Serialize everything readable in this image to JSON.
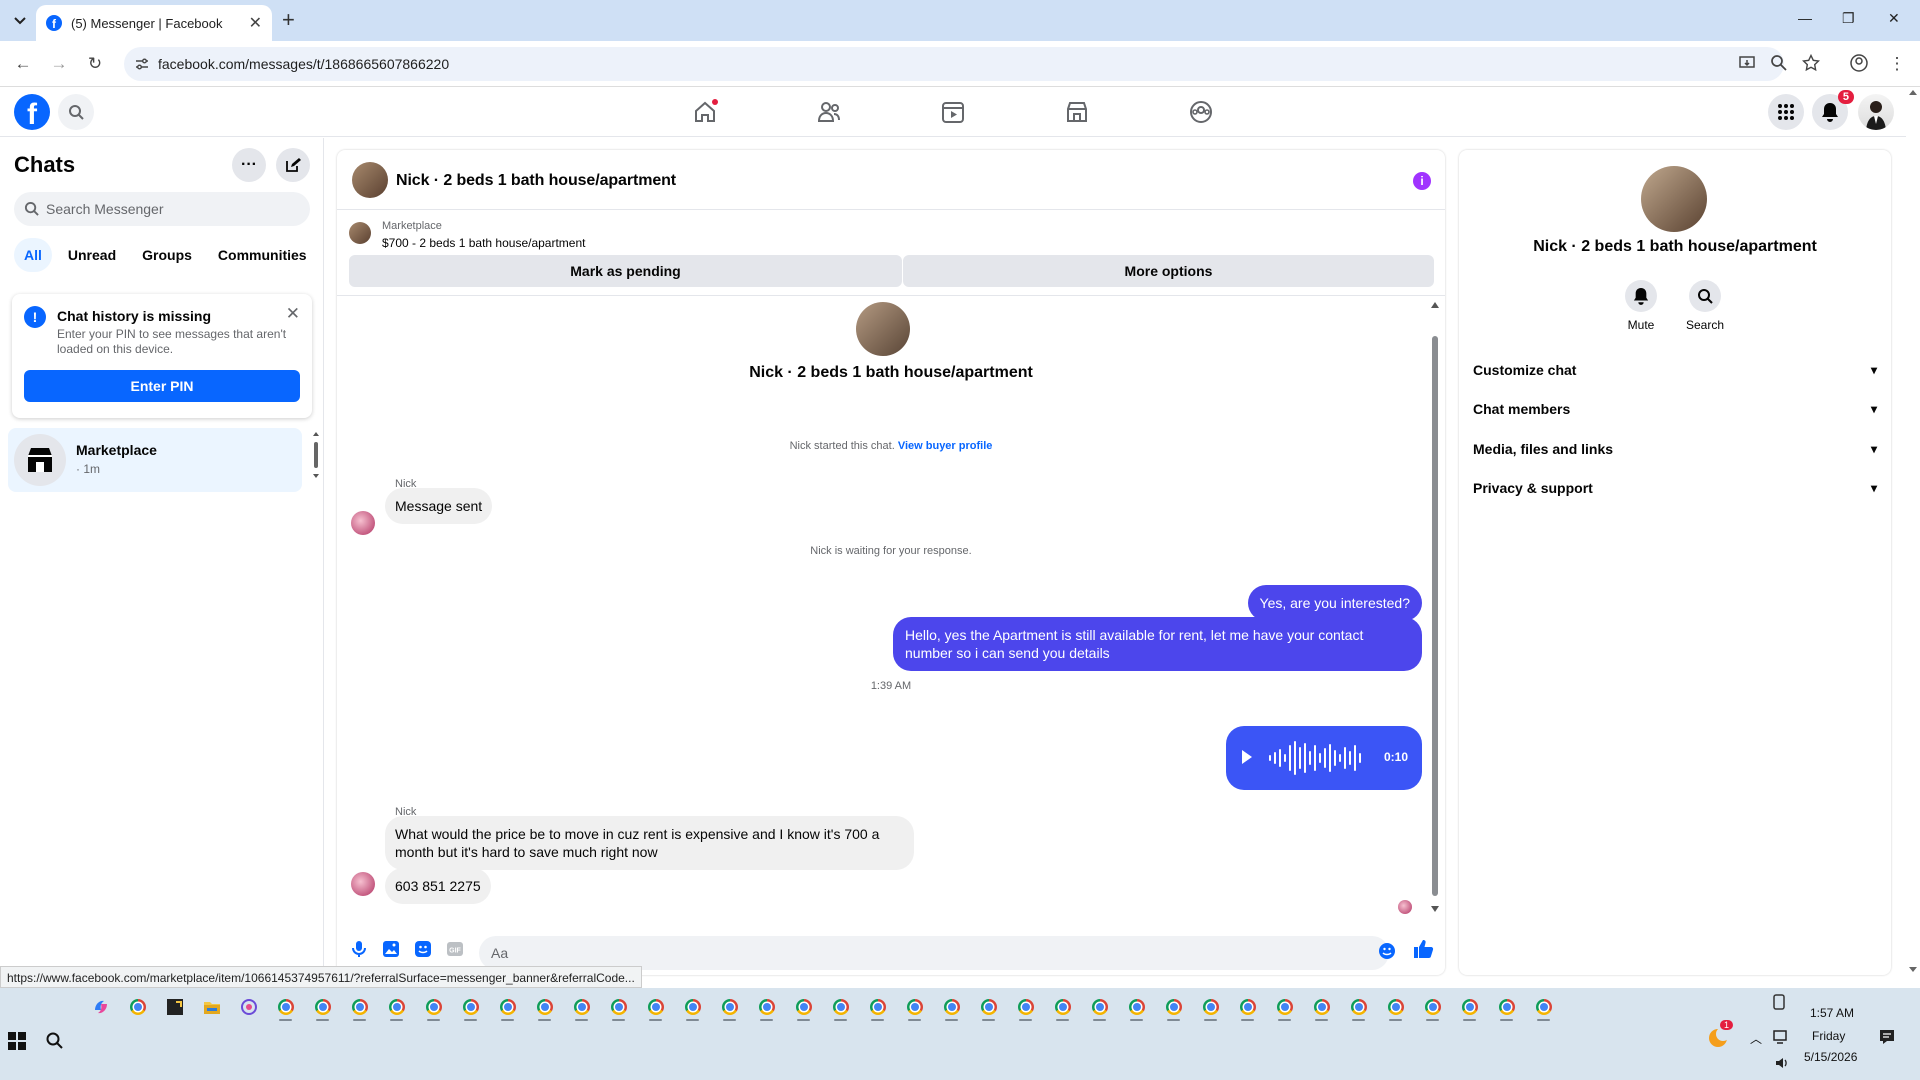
{
  "browser": {
    "tab_title": "(5) Messenger | Facebook",
    "url": "facebook.com/messages/t/1868665607866220",
    "status_url": "https://www.facebook.com/marketplace/item/1066145374957611/?referralSurface=messenger_banner&referralCode..."
  },
  "fb": {
    "notif_count": "5"
  },
  "sidebar": {
    "title": "Chats",
    "search_placeholder": "Search Messenger",
    "filters": [
      "All",
      "Unread",
      "Groups",
      "Communities"
    ],
    "notice": {
      "title": "Chat history is missing",
      "desc": "Enter your PIN to see messages that aren't loaded on this device.",
      "button": "Enter PIN"
    },
    "conversation": {
      "name": "Marketplace",
      "snippet": "· 1m"
    }
  },
  "chat": {
    "header_name": "Nick · 2 beds 1 bath house/apartment",
    "banner": {
      "label": "Marketplace",
      "listing": "$700 - 2 beds 1 bath house/apartment",
      "pending_button": "Mark as pending",
      "more_button": "More options"
    },
    "intro_name": "Nick · 2 beds 1 bath house/apartment",
    "started_text": "Nick started this chat.",
    "buyer_link": "View buyer profile",
    "sender1": "Nick",
    "msg_sent": "Message sent",
    "waiting": "Nick is waiting for your response.",
    "out1": "Yes, are you interested?",
    "out2": "Hello, yes the Apartment is still available for rent, let me have your contact number so i can send you details",
    "time": "1:39 AM",
    "voice_duration": "0:10",
    "sender2": "Nick",
    "in2": "What would the price be to move in cuz rent is expensive and I know it's 700 a month but it's hard to save much right now",
    "in3": "603 851 2275",
    "composer_placeholder": "Aa"
  },
  "right_panel": {
    "name": "Nick · 2 beds 1 bath house/apartment",
    "mute": "Mute",
    "search": "Search",
    "sections": [
      "Customize chat",
      "Chat members",
      "Media, files and links",
      "Privacy & support"
    ]
  },
  "taskbar": {
    "time": "1:57 AM",
    "day": "Friday",
    "date": "5/15/2026",
    "weather_badge": "1"
  }
}
